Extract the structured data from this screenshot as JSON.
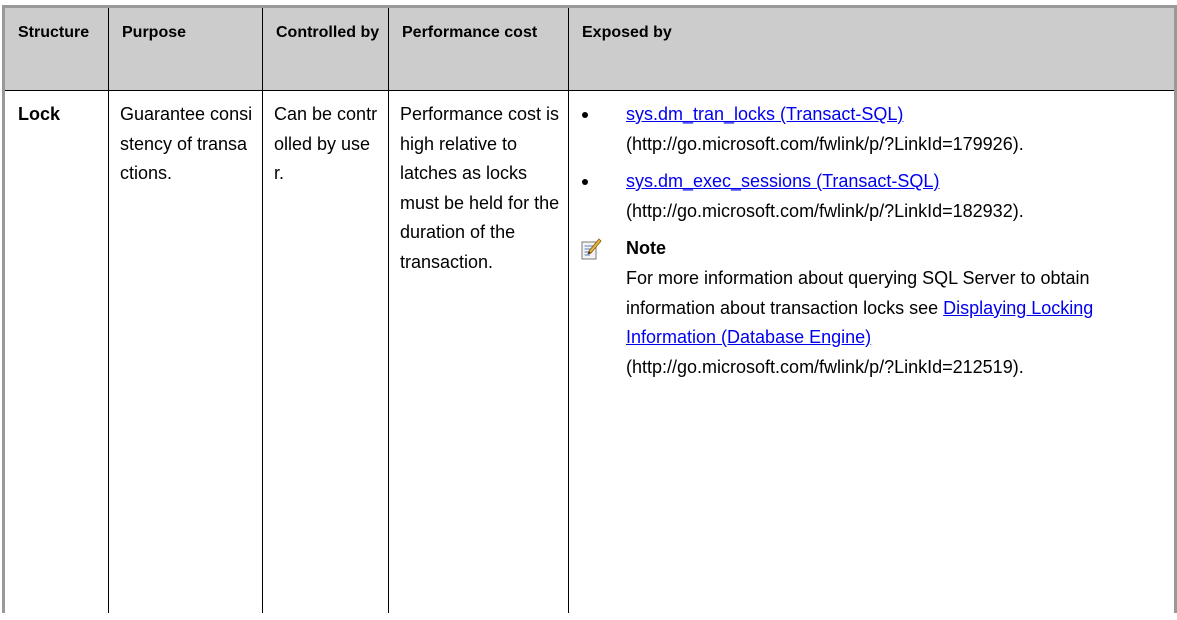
{
  "table": {
    "headers": [
      "Structure",
      "Purpose",
      "Controlled by",
      "Performance cost",
      "Exposed by"
    ],
    "rows": [
      {
        "structure": "Lock",
        "purpose": "Guarantee consistency of transactions.",
        "controlled_by": "Can be controlled by user.",
        "performance_cost": "Performance cost is high relative to latches as locks must be held for the duration of the transaction.",
        "exposed_by": {
          "items": [
            {
              "link_text": "sys.dm_tran_locks (Transact-SQL)",
              "url_text": "(http://go.microsoft.com/fwlink/p/?LinkId=179926)."
            },
            {
              "link_text": "sys.dm_exec_sessions (Transact-SQL)",
              "url_text": "(http://go.microsoft.com/fwlink/p/?LinkId=182932)."
            }
          ],
          "note": {
            "title": "Note",
            "icon": "note-pencil-icon",
            "text_before": "For more information about querying SQL Server to obtain information about transaction locks see ",
            "link_text": "Displaying Locking Information (Database Engine)",
            "url_text": "(http://go.microsoft.com/fwlink/p/?LinkId=212519)."
          }
        }
      }
    ]
  },
  "colors": {
    "header_background": "#cccccc",
    "outer_border": "#999999",
    "inner_border": "#000000",
    "link": "#0000ee"
  }
}
